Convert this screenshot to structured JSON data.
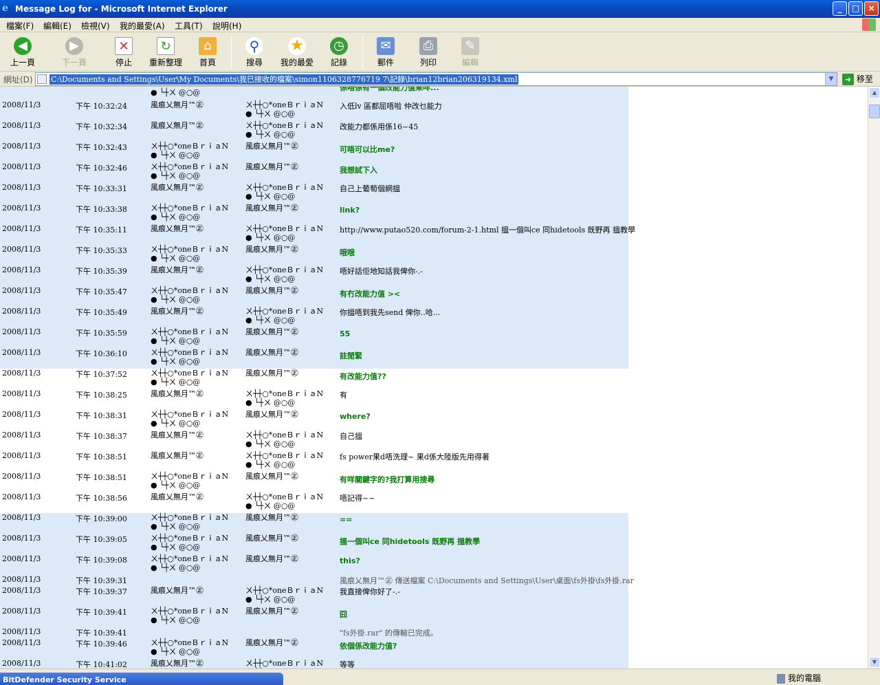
{
  "window": {
    "title": "Message Log for - Microsoft Internet Explorer",
    "minimize": "_",
    "maximize": "□",
    "close": "×"
  },
  "menu": [
    "檔案(F)",
    "編輯(E)",
    "檢視(V)",
    "我的最愛(A)",
    "工具(T)",
    "說明(H)"
  ],
  "toolbar": {
    "back": "上一頁",
    "forward": "下一頁",
    "stop": "停止",
    "refresh": "重新整理",
    "home": "首頁",
    "search": "搜尋",
    "favorites": "我的最愛",
    "history": "記錄",
    "mail": "郵件",
    "print": "列印",
    "edit": "編輯"
  },
  "address": {
    "label": "網址(D)",
    "value": "C:\\Documents and Settings\\User\\My Documents\\我已接收的檔案\\simon1106328776719 7\\記錄\\brian12brian206319134.xml",
    "go": "移至"
  },
  "names": {
    "a": "風痕乂無月™㊣",
    "b1": "ㄨ┼┼○*oneＢｒｉａN",
    "b2": "● └┼ㄨ @○@"
  },
  "rows": [
    {
      "date": "2008/11/3",
      "time": "下午 10:32:24",
      "from": "a",
      "to": "b",
      "msg": "入低lv 區都屈唔啦 仲改乜能力",
      "style": "n"
    },
    {
      "date": "2008/11/3",
      "time": "下午 10:32:34",
      "from": "a",
      "to": "b",
      "msg": "改能力都係用係16~45",
      "style": "n"
    },
    {
      "date": "2008/11/3",
      "time": "下午 10:32:43",
      "from": "b",
      "to": "a",
      "msg": "可唔可以比me?",
      "style": "g"
    },
    {
      "date": "2008/11/3",
      "time": "下午 10:32:46",
      "from": "b",
      "to": "a",
      "msg": "我想試下入",
      "style": "g"
    },
    {
      "date": "2008/11/3",
      "time": "下午 10:33:31",
      "from": "a",
      "to": "b",
      "msg": "自己上葡萄個網搵",
      "style": "n"
    },
    {
      "date": "2008/11/3",
      "time": "下午 10:33:38",
      "from": "b",
      "to": "a",
      "msg": "link?",
      "style": "g"
    },
    {
      "date": "2008/11/3",
      "time": "下午 10:35:11",
      "from": "a",
      "to": "b",
      "msg": "http://www.putao520.com/forum-2-1.html 搵一個叫ce 同hidetools 既野再 搵教學",
      "style": "n"
    },
    {
      "date": "2008/11/3",
      "time": "下午 10:35:33",
      "from": "b",
      "to": "a",
      "msg": "哦哦",
      "style": "g"
    },
    {
      "date": "2008/11/3",
      "time": "下午 10:35:39",
      "from": "a",
      "to": "b",
      "msg": "唔好話佢地知話我俾你-.-",
      "style": "n"
    },
    {
      "date": "2008/11/3",
      "time": "下午 10:35:47",
      "from": "b",
      "to": "a",
      "msg": "有冇改能力值 ><",
      "style": "g"
    },
    {
      "date": "2008/11/3",
      "time": "下午 10:35:49",
      "from": "a",
      "to": "b",
      "msg": "你搵唔到我先send 俾你..哈...",
      "style": "n"
    },
    {
      "date": "2008/11/3",
      "time": "下午 10:35:59",
      "from": "b",
      "to": "a",
      "msg": "55",
      "style": "g"
    },
    {
      "date": "2008/11/3",
      "time": "下午 10:36:10",
      "from": "b",
      "to": "a",
      "msg": "註閒緊",
      "style": "g"
    },
    {
      "date": "2008/11/3",
      "time": "下午 10:37:52",
      "from": "b",
      "to": "a",
      "msg": "有改能力值??",
      "style": "g"
    },
    {
      "date": "2008/11/3",
      "time": "下午 10:38:25",
      "from": "a",
      "to": "b",
      "msg": "有",
      "style": "n"
    },
    {
      "date": "2008/11/3",
      "time": "下午 10:38:31",
      "from": "b",
      "to": "a",
      "msg": "where?",
      "style": "g"
    },
    {
      "date": "2008/11/3",
      "time": "下午 10:38:37",
      "from": "a",
      "to": "b",
      "msg": "自己搵",
      "style": "n"
    },
    {
      "date": "2008/11/3",
      "time": "下午 10:38:51",
      "from": "a",
      "to": "b",
      "msg": "fs power果d唔洗理~ 果d係大陸版先用得著",
      "style": "n"
    },
    {
      "date": "2008/11/3",
      "time": "下午 10:38:51",
      "from": "b",
      "to": "a",
      "msg": "有咩關鍵字的?我打算用搜尋",
      "style": "g"
    },
    {
      "date": "2008/11/3",
      "time": "下午 10:38:56",
      "from": "a",
      "to": "b",
      "msg": "唔記得~~",
      "style": "n"
    },
    {
      "date": "2008/11/3",
      "time": "下午 10:39:00",
      "from": "b",
      "to": "a",
      "msg": "==",
      "style": "g"
    },
    {
      "date": "2008/11/3",
      "time": "下午 10:39:05",
      "from": "b",
      "to": "a",
      "msg": "搵一個叫ce 同hidetools 既野再 搵教學",
      "style": "g"
    },
    {
      "date": "2008/11/3",
      "time": "下午 10:39:08",
      "from": "b",
      "to": "a",
      "msg": "this?",
      "style": "g"
    },
    {
      "date": "2008/11/3",
      "time": "下午 10:39:31",
      "from": "",
      "to": "",
      "msg": "風痕乂無月™㊣ 傳送檔案 C:\\Documents and Settings\\User\\桌面\\fs外掛\\fs外掛.rar",
      "style": "s"
    },
    {
      "date": "2008/11/3",
      "time": "下午 10:39:37",
      "from": "a",
      "to": "b",
      "msg": "我直接俾你好了-.-",
      "style": "n"
    },
    {
      "date": "2008/11/3",
      "time": "下午 10:39:41",
      "from": "b",
      "to": "a",
      "msg": "囧",
      "style": "g"
    },
    {
      "date": "2008/11/3",
      "time": "下午 10:39:41",
      "from": "",
      "to": "",
      "msg": "\"fs外掛.rar\" 的傳輸已完成。",
      "style": "s"
    },
    {
      "date": "2008/11/3",
      "time": "下午 10:39:46",
      "from": "b",
      "to": "a",
      "msg": "依個係改能力值?",
      "style": "g"
    },
    {
      "date": "2008/11/3",
      "time": "下午 10:41:02",
      "from": "a",
      "to": "b",
      "msg": "等等",
      "style": "n"
    }
  ],
  "top_partial": {
    "msg": "係唔係有一個改能力值果咩..."
  },
  "status": {
    "zone": "我的電腦",
    "taskbar": "BitDefender Security Service"
  }
}
